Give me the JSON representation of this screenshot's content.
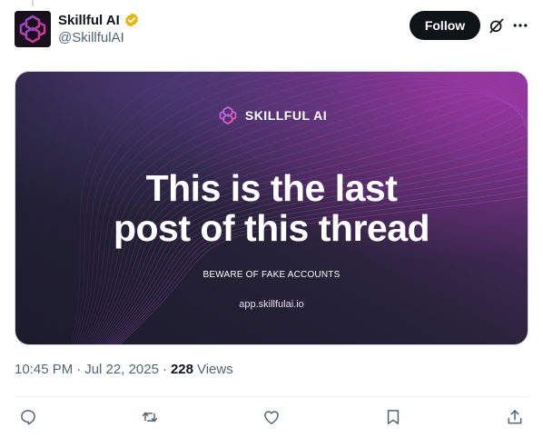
{
  "post": {
    "author": {
      "display_name": "Skillful AI",
      "handle": "@SkillfulAI",
      "verified_badge": "gold-verified-badge",
      "avatar_icon": "skillful-ai-brain-logo"
    },
    "follow_label": "Follow",
    "header_icons": [
      "grok-icon",
      "more-icon"
    ],
    "media": {
      "brand_name": "SKILLFUL AI",
      "headline_line1": "This is the last",
      "headline_line2": "post of this thread",
      "warning": "BEWARE OF FAKE ACCOUNTS",
      "url": "app.skillfulai.io"
    },
    "time": "10:45 PM",
    "date": "Jul 22, 2025",
    "views_count": "228",
    "views_label": "Views"
  },
  "actions": [
    "reply-icon",
    "repost-icon",
    "like-icon",
    "bookmark-icon",
    "share-icon"
  ],
  "colors": {
    "accent_dark": "#0f1419",
    "secondary_text": "#536471",
    "verified_gold": "#e2b719",
    "media_purple": "#7a2a8c",
    "media_dark": "#1f1a2e"
  }
}
